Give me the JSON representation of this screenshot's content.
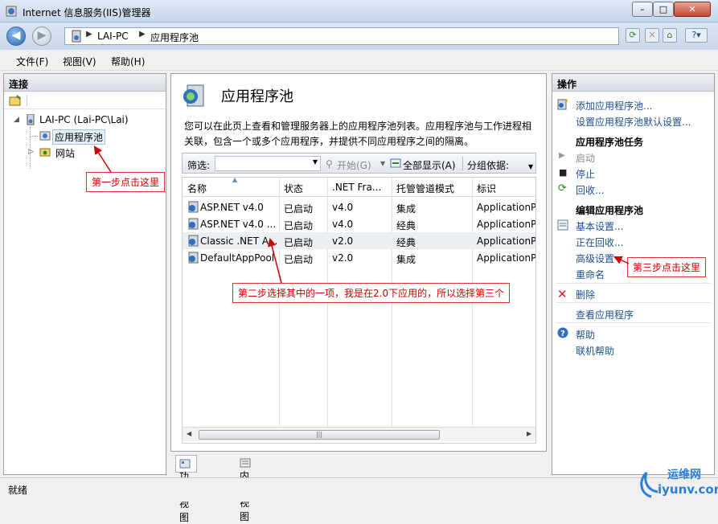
{
  "window": {
    "title": "Internet 信息服务(IIS)管理器",
    "min": "–",
    "max": "□",
    "close": "✕"
  },
  "address": {
    "crumbs": [
      "LAI-PC",
      "应用程序池"
    ]
  },
  "toolbar_icons": [
    "refresh-icon",
    "stop-icon",
    "home-icon",
    "help-icon"
  ],
  "menu": {
    "file": "文件(F)",
    "view": "视图(V)",
    "help": "帮助(H)"
  },
  "connections": {
    "header": "连接",
    "tree": [
      {
        "label": "LAI-PC (Lai-PC\\Lai)"
      },
      {
        "label": "应用程序池"
      },
      {
        "label": "网站"
      }
    ]
  },
  "center": {
    "title": "应用程序池",
    "description": "您可以在此页上查看和管理服务器上的应用程序池列表。应用程序池与工作进程相关联，包含一个或多个应用程序，并提供不同应用程序之间的隔离。",
    "filter": {
      "label": "筛选:",
      "start": "开始(G)",
      "show_all": "全部显示(A)",
      "group_by": "分组依据:"
    },
    "columns": [
      "名称",
      "状态",
      ".NET Fra...",
      "托管管道模式",
      "标识"
    ],
    "rows": [
      {
        "name": "ASP.NET v4.0",
        "status": "已启动",
        "net": "v4.0",
        "pipeline": "集成",
        "identity": "ApplicationPo"
      },
      {
        "name": "ASP.NET v4.0 ...",
        "status": "已启动",
        "net": "v4.0",
        "pipeline": "经典",
        "identity": "ApplicationPo"
      },
      {
        "name": "Classic .NET A...",
        "status": "已启动",
        "net": "v2.0",
        "pipeline": "经典",
        "identity": "ApplicationPo"
      },
      {
        "name": "DefaultAppPool",
        "status": "已启动",
        "net": "v2.0",
        "pipeline": "集成",
        "identity": "ApplicationPo"
      }
    ]
  },
  "view_tabs": {
    "features": "功能视图",
    "content": "内容视图"
  },
  "actions": {
    "header": "操作",
    "add_pool": "添加应用程序池...",
    "set_defaults": "设置应用程序池默认设置...",
    "tasks_group": "应用程序池任务",
    "start": "启动",
    "stop": "停止",
    "recycle": "回收...",
    "edit_group": "编辑应用程序池",
    "basic": "基本设置...",
    "recycling": "正在回收...",
    "advanced": "高级设置",
    "rename": "重命名",
    "delete": "删除",
    "view_apps": "查看应用程序",
    "help": "帮助",
    "online_help": "联机帮助"
  },
  "status": "就绪",
  "annotations": {
    "step1": "第一步点击这里",
    "step2": "第二步选择其中的一项，我是在2.0下应用的，所以选择第三个",
    "step3": "第三步点击这里"
  },
  "watermark": {
    "line1": "运维网",
    "line2": "iyunv.com"
  },
  "colors": {
    "annotation": "#cc0000",
    "link": "#1b4f8f"
  }
}
